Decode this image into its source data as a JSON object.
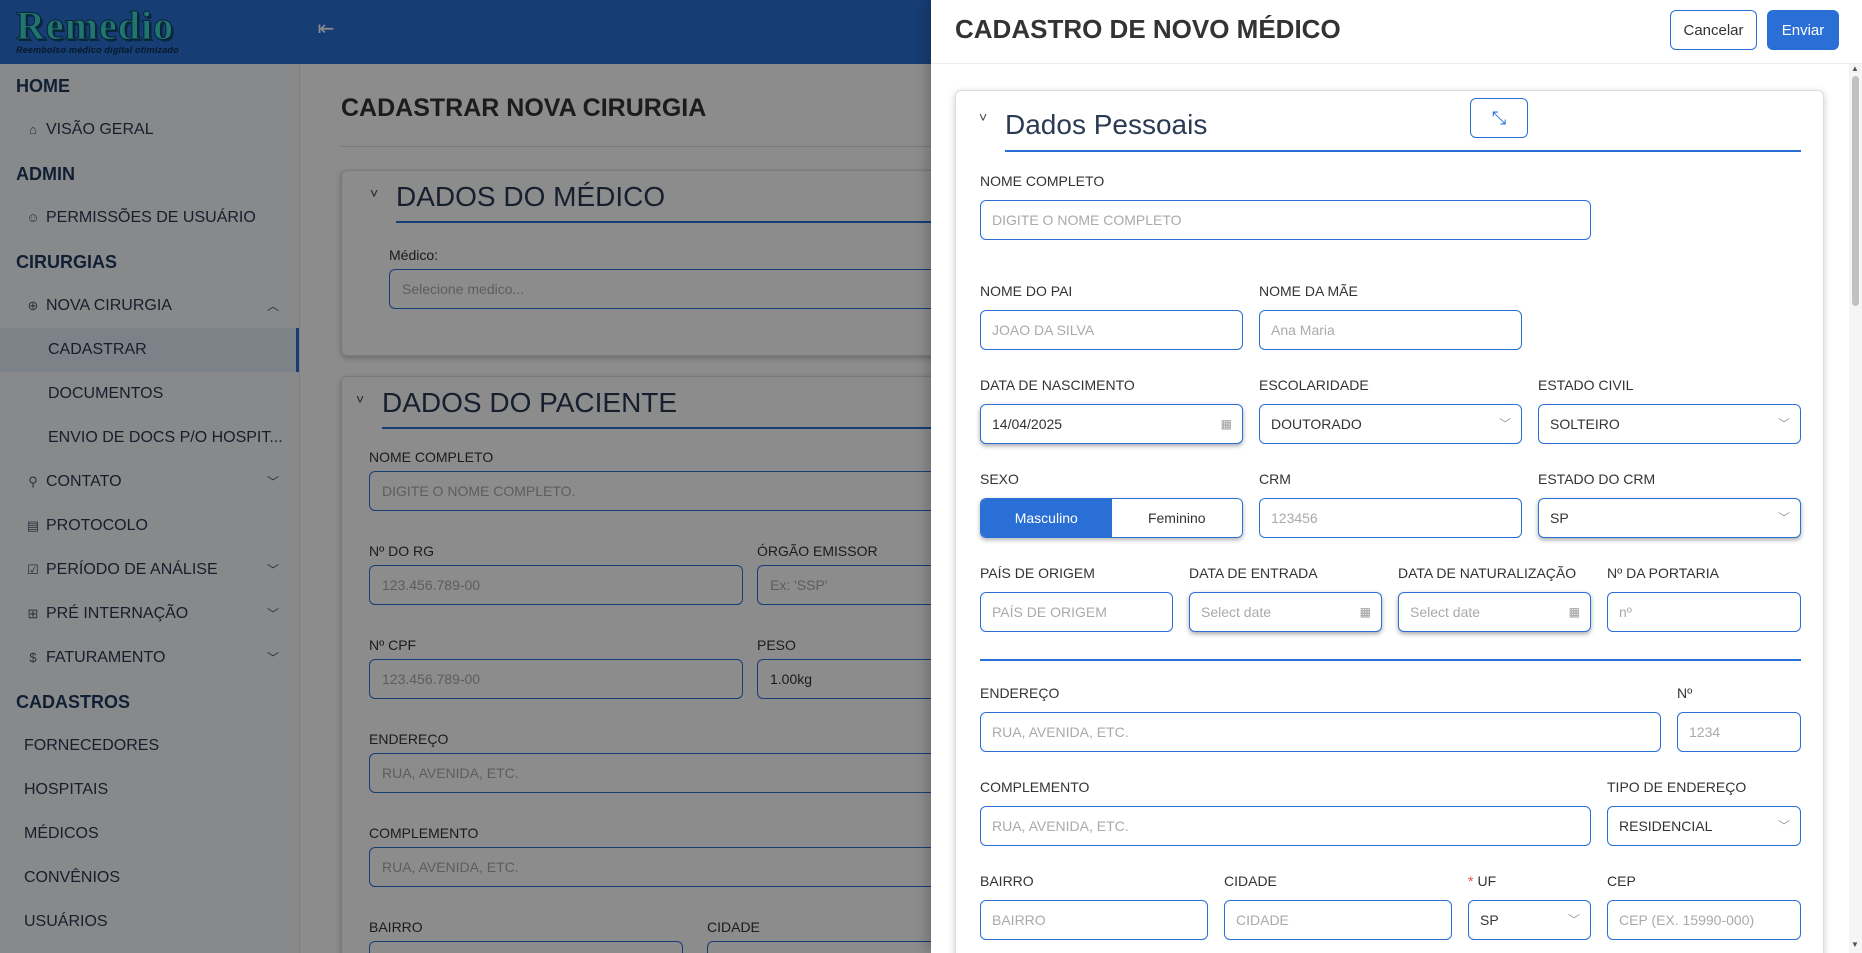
{
  "app": {
    "logo_title": "Remedio",
    "logo_subtitle": "Reembolso médico digital otimizado",
    "menu_toggle_icon": "menu-collapse-icon",
    "accent_color": "#2a6fd6"
  },
  "sidebar": {
    "sections": [
      {
        "title": "HOME",
        "items": [
          {
            "label": "VISÃO GERAL",
            "icon": "home-icon"
          }
        ]
      },
      {
        "title": "ADMIN",
        "items": [
          {
            "label": "PERMISSÕES DE USUÁRIO",
            "icon": "user-icon"
          }
        ]
      },
      {
        "title": "CIRURGIAS",
        "items": [
          {
            "label": "NOVA CIRURGIA",
            "icon": "plus-circle-icon",
            "expanded": true,
            "children": [
              "CADASTRAR",
              "DOCUMENTOS",
              "ENVIO DE DOCS P/O HOSPIT..."
            ]
          },
          {
            "label": "CONTATO",
            "icon": "link-icon"
          },
          {
            "label": "PROTOCOLO",
            "icon": "document-icon"
          },
          {
            "label": "PERÍODO DE ANÁLISE",
            "icon": "checkbox-icon"
          },
          {
            "label": "PRÉ INTERNAÇÃO",
            "icon": "hospital-icon"
          },
          {
            "label": "FATURAMENTO",
            "icon": "dollar-icon"
          }
        ]
      },
      {
        "title": "CADASTROS",
        "items": [
          {
            "label": "FORNECEDORES"
          },
          {
            "label": "HOSPITAIS"
          },
          {
            "label": "MÉDICOS"
          },
          {
            "label": "CONVÊNIOS"
          },
          {
            "label": "USUÁRIOS"
          }
        ]
      }
    ],
    "active_item": "CADASTRAR"
  },
  "main": {
    "title": "CADASTRAR NOVA CIRURGIA",
    "medico_card": {
      "title": "DADOS DO MÉDICO",
      "medico_label": "Médico:",
      "medico_placeholder": "Selecione medico..."
    },
    "paciente_card": {
      "title": "DADOS DO PACIENTE",
      "nome_label": "NOME COMPLETO",
      "nome_placeholder": "DIGITE O NOME COMPLETO.",
      "rg_label": "Nº DO RG",
      "rg_placeholder": "123.456.789-00",
      "orgao_label": "ÓRGÃO EMISSOR",
      "orgao_placeholder": "Ex: 'SSP'",
      "cpf_label": "Nº CPF",
      "cpf_placeholder": "123.456.789-00",
      "peso_label": "PESO",
      "peso_value": "1.00kg",
      "endereco_label": "ENDEREÇO",
      "endereco_placeholder": "RUA, AVENIDA, ETC.",
      "complemento_label": "COMPLEMENTO",
      "complemento_placeholder": "RUA, AVENIDA, ETC.",
      "bairro_label": "BAIRRO",
      "cidade_label": "CIDADE"
    }
  },
  "drawer": {
    "title": "CADASTRO DE NOVO MÉDICO",
    "cancel_label": "Cancelar",
    "submit_label": "Enviar",
    "section_title": "Dados Pessoais",
    "collapse_icon": "collapse-arrows-icon",
    "fields": {
      "nome_completo": {
        "label": "NOME COMPLETO",
        "placeholder": "DIGITE O NOME COMPLETO"
      },
      "nome_pai": {
        "label": "NOME DO PAI",
        "placeholder": "JOAO DA SILVA"
      },
      "nome_mae": {
        "label": "NOME DA MÃE",
        "placeholder": "Ana Maria"
      },
      "data_nascimento": {
        "label": "DATA DE NASCIMENTO",
        "value": "14/04/2025"
      },
      "escolaridade": {
        "label": "ESCOLARIDADE",
        "value": "DOUTORADO"
      },
      "estado_civil": {
        "label": "ESTADO CIVIL",
        "value": "SOLTEIRO"
      },
      "sexo": {
        "label": "SEXO",
        "options": [
          "Masculino",
          "Feminino"
        ],
        "selected": "Masculino"
      },
      "crm": {
        "label": "CRM",
        "placeholder": "123456"
      },
      "estado_crm": {
        "label": "ESTADO DO CRM",
        "value": "SP"
      },
      "pais_origem": {
        "label": "PAÍS DE ORIGEM",
        "placeholder": "PAÍS DE ORIGEM"
      },
      "data_entrada": {
        "label": "DATA DE ENTRADA",
        "placeholder": "Select date"
      },
      "data_naturalizacao": {
        "label": "DATA DE NATURALIZAÇÃO",
        "placeholder": "Select date"
      },
      "num_portaria": {
        "label": "Nº DA PORTARIA",
        "placeholder": "nº"
      },
      "endereco": {
        "label": "ENDEREÇO",
        "placeholder": "RUA, AVENIDA, ETC."
      },
      "numero": {
        "label": "Nº",
        "placeholder": "1234"
      },
      "complemento": {
        "label": "COMPLEMENTO",
        "placeholder": "RUA, AVENIDA, ETC."
      },
      "tipo_endereco": {
        "label": "TIPO DE ENDEREÇO",
        "value": "RESIDENCIAL"
      },
      "bairro": {
        "label": "BAIRRO",
        "placeholder": "BAIRRO"
      },
      "cidade": {
        "label": "CIDADE",
        "placeholder": "CIDADE"
      },
      "uf": {
        "label": "UF",
        "required_mark": "*",
        "value": "SP"
      },
      "cep": {
        "label": "CEP",
        "placeholder": "CEP (EX. 15990-000)"
      }
    }
  }
}
